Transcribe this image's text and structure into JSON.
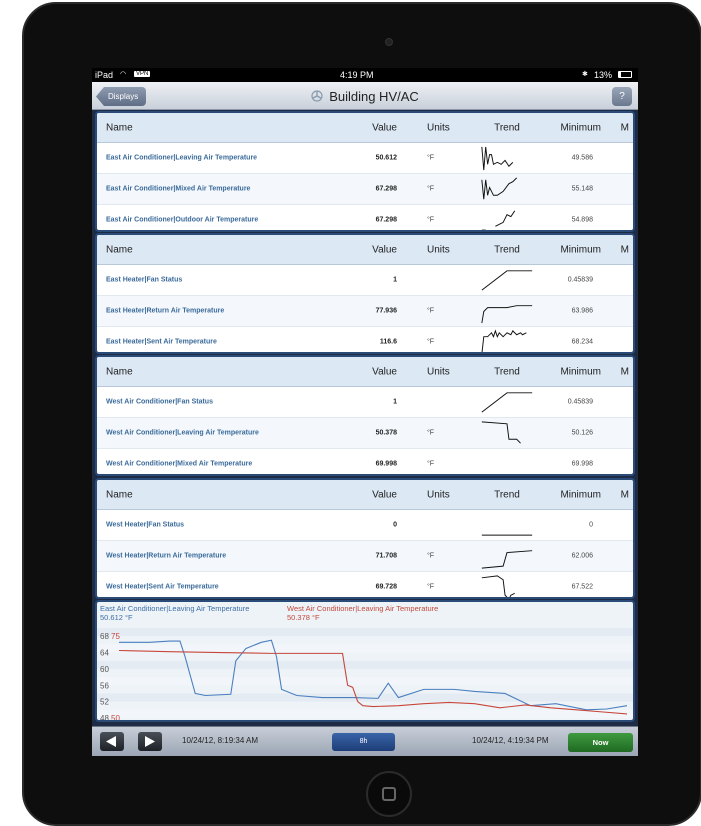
{
  "status_bar": {
    "carrier": "iPad",
    "vpn": "VPN",
    "time": "4:19 PM",
    "battery": "13%"
  },
  "nav": {
    "back_label": "Displays",
    "title": "Building HV/AC",
    "help_label": "?"
  },
  "columns": {
    "name": "Name",
    "value": "Value",
    "units": "Units",
    "trend": "Trend",
    "minimum": "Minimum",
    "maximum": "M"
  },
  "panels": [
    {
      "rows": [
        {
          "name": "East Air Conditioner|Leaving Air Temperature",
          "value": "50.612",
          "units": "°F",
          "minimum": "49.586"
        },
        {
          "name": "East Air Conditioner|Mixed Air Temperature",
          "value": "67.298",
          "units": "°F",
          "minimum": "55.148"
        },
        {
          "name": "East Air Conditioner|Outdoor Air Temperature",
          "value": "67.298",
          "units": "°F",
          "minimum": "54.898"
        }
      ]
    },
    {
      "rows": [
        {
          "name": "East Heater|Fan Status",
          "value": "1",
          "units": "",
          "minimum": "0.45839"
        },
        {
          "name": "East Heater|Return Air Temperature",
          "value": "77.936",
          "units": "°F",
          "minimum": "63.986"
        },
        {
          "name": "East Heater|Sent Air Temperature",
          "value": "116.6",
          "units": "°F",
          "minimum": "68.234"
        }
      ]
    },
    {
      "rows": [
        {
          "name": "West Air Conditioner|Fan Status",
          "value": "1",
          "units": "",
          "minimum": "0.45839"
        },
        {
          "name": "West Air Conditioner|Leaving Air Temperature",
          "value": "50.378",
          "units": "°F",
          "minimum": "50.126"
        },
        {
          "name": "West Air Conditioner|Mixed Air Temperature",
          "value": "69.998",
          "units": "°F",
          "minimum": "69.998"
        }
      ]
    },
    {
      "rows": [
        {
          "name": "West Heater|Fan Status",
          "value": "0",
          "units": "",
          "minimum": "0"
        },
        {
          "name": "West Heater|Return Air Temperature",
          "value": "71.708",
          "units": "°F",
          "minimum": "62.006"
        },
        {
          "name": "West Heater|Sent Air Temperature",
          "value": "69.728",
          "units": "°F",
          "minimum": "67.522"
        }
      ]
    }
  ],
  "chart_legend": {
    "series_a_name": "East Air Conditioner|Leaving Air Temperature",
    "series_a_value": "50.612 °F",
    "series_b_name": "West Air Conditioner|Leaving Air Temperature",
    "series_b_value": "50.378 °F"
  },
  "chart_data": {
    "type": "line",
    "ylim": [
      48,
      70
    ],
    "yticks": [
      48,
      52,
      56,
      60,
      64,
      68
    ],
    "ytick_labels": [
      "48",
      "52",
      "56",
      "60",
      "64",
      "68"
    ],
    "secondary_tick_labels": [
      {
        "value": 50,
        "label": "50"
      },
      {
        "value": 75,
        "label": "75"
      }
    ],
    "series": [
      {
        "name": "East Air Conditioner|Leaving Air Temperature",
        "color": "#4a7fbf",
        "x": [
          0,
          6,
          10,
          12,
          13,
          15,
          17,
          22,
          23,
          25,
          28,
          30,
          31,
          32,
          35,
          40,
          46,
          51,
          53,
          55,
          60,
          66,
          70,
          76,
          81,
          86,
          92,
          96,
          100
        ],
        "y": [
          66.5,
          66.5,
          66.8,
          66.8,
          63,
          54,
          53.5,
          53.8,
          62,
          65,
          66.5,
          67,
          63,
          55,
          53.5,
          53,
          53,
          52.8,
          56.5,
          53,
          55,
          55,
          54.5,
          54,
          51,
          51.5,
          50,
          50.2,
          51
        ]
      },
      {
        "name": "West Air Conditioner|Leaving Air Temperature",
        "color": "#c6473a",
        "x": [
          0,
          10,
          20,
          30,
          44,
          45,
          46,
          47,
          48,
          50,
          55,
          60,
          65,
          70,
          75,
          80,
          85,
          90,
          95,
          100
        ],
        "y": [
          64.5,
          64.2,
          64,
          63.8,
          63.8,
          56,
          55.5,
          52,
          51,
          50.8,
          51,
          51.5,
          51.8,
          51.5,
          50.5,
          51.2,
          50.5,
          50,
          49.5,
          49
        ]
      }
    ]
  },
  "toolbar": {
    "start_time": "10/24/12, 8:19:34 AM",
    "range_label": "8h",
    "end_time": "10/24/12, 4:19:34 PM",
    "now_label": "Now"
  },
  "colors": {
    "panel_border": "#2a4a78",
    "header_bg": "#dce8f4",
    "name_text": "#3a6a9a",
    "now_green": "#2f8a31",
    "range_blue": "#2a4f94"
  }
}
